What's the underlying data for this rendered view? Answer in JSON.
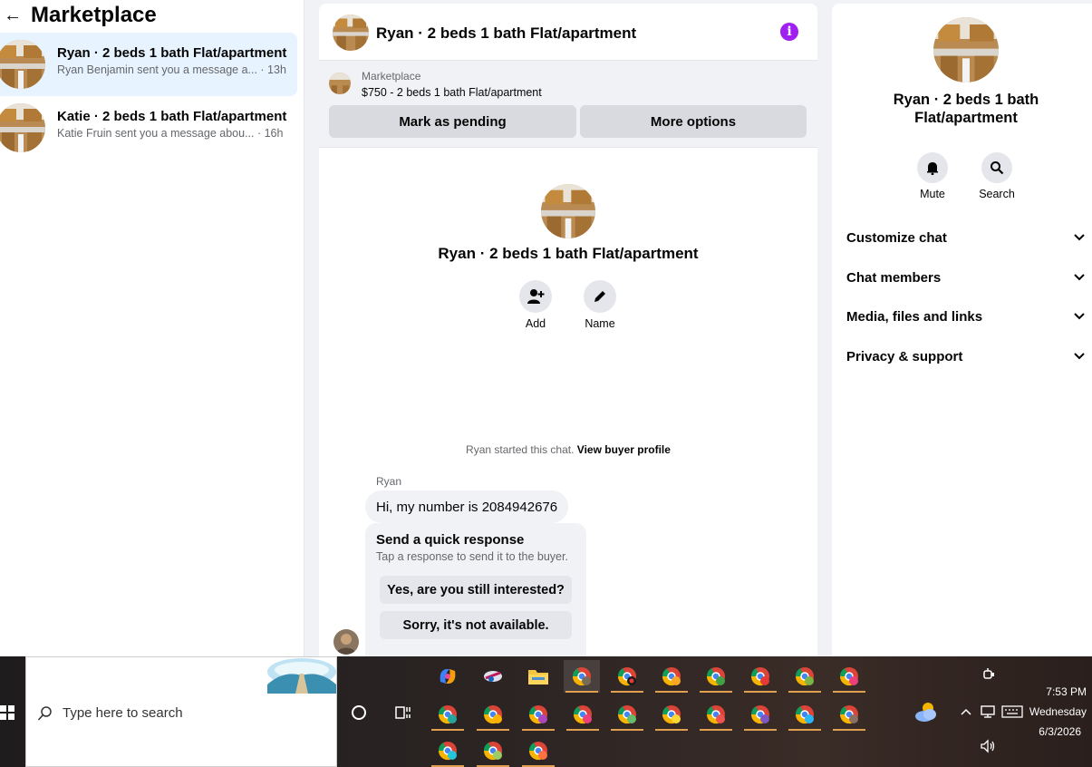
{
  "left": {
    "title": "Marketplace",
    "conversations": [
      {
        "title": "Ryan · 2 beds 1 bath Flat/apartment",
        "preview": "Ryan Benjamin sent you a message a... · 13h",
        "active": true
      },
      {
        "title": "Katie · 2 beds 1 bath Flat/apartment",
        "preview": "Katie Fruin sent you a message abou... · 16h",
        "active": false
      }
    ]
  },
  "chat": {
    "title": "Ryan · 2 beds 1 bath Flat/apartment",
    "banner_label": "Marketplace",
    "banner_listing": "$750 - 2 beds 1 bath Flat/apartment",
    "mark_pending": "Mark as pending",
    "more_options": "More options",
    "intro_title": "Ryan · 2 beds 1 bath Flat/apartment",
    "add_label": "Add",
    "name_label": "Name",
    "started_text": "Ryan started this chat.",
    "buyer_profile_link": "View buyer profile",
    "sender": "Ryan",
    "message": "Hi, my number is 2084942676",
    "quick_title": "Send a quick response",
    "quick_sub": "Tap a response to send it to the buyer.",
    "quick_responses": [
      "Yes, are you still interested?",
      "Sorry, it's not available."
    ]
  },
  "info": {
    "title": "Ryan · 2 beds 1 bath Flat/apartment",
    "mute_label": "Mute",
    "search_label": "Search",
    "sections": [
      "Customize chat",
      "Chat members",
      "Media, files and links",
      "Privacy & support"
    ]
  },
  "taskbar": {
    "search_placeholder": "Type here to search",
    "time": "7:53 PM",
    "day": "Wednesday",
    "date": "6/3/2026"
  },
  "colors": {
    "accent_purple": "#a020f0",
    "active_row": "#e7f3ff",
    "button_gray": "#d8dadf"
  }
}
